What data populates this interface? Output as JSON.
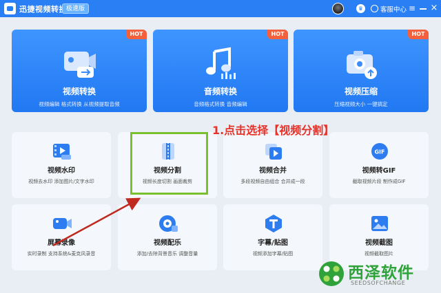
{
  "titlebar": {
    "app_title": "迅捷视频转换器",
    "edition": "极速版",
    "service_label": "客服中心",
    "menu_glyph": "≡",
    "close_glyph": "×"
  },
  "big_cards": [
    {
      "title": "视频转换",
      "desc": "视频编辑 格式转换 从视频提取音频",
      "badge": "HOT"
    },
    {
      "title": "音频转换",
      "desc": "音频格式转换 音频编辑",
      "badge": "HOT"
    },
    {
      "title": "视频压缩",
      "desc": "压缩视频大小 一键搞定",
      "badge": "HOT"
    }
  ],
  "small_cards_row1": [
    {
      "title": "视频水印",
      "desc": "视频去水印 添加图片/文字水印"
    },
    {
      "title": "视频分割",
      "desc": "视频长度切割 画面裁剪"
    },
    {
      "title": "视频合并",
      "desc": "多段视频自由组合 合并成一段"
    },
    {
      "title": "视频转GIF",
      "desc": "截取视频片段 制作成GIF"
    }
  ],
  "small_cards_row2": [
    {
      "title": "屏幕录像",
      "desc": "实时录制 支持系统&麦克风录音"
    },
    {
      "title": "视频配乐",
      "desc": "添加/去除背景音乐 调整音量"
    },
    {
      "title": "字幕/贴图",
      "desc": "视频添加字幕/贴图"
    },
    {
      "title": "视频截图",
      "desc": "视频截取图片"
    }
  ],
  "gif_badge": "GIF",
  "annotation": "1.点击选择【视频分割】",
  "watermark": {
    "name": "西泽软件",
    "domain": "SEEDSOFCHANGE"
  },
  "colors": {
    "titlebar": "#2b7ff5",
    "card_blue": "#2178f2",
    "hot": "#f4603c",
    "highlight": "#7ac02c",
    "annotation": "#e6332a",
    "watermark": "#2fa33a"
  },
  "icons": {
    "video_convert": "video-camera-icon",
    "audio_convert": "music-note-icon",
    "video_compress": "camera-compress-icon",
    "watermark": "film-watermark-icon",
    "split": "scissors-split-icon",
    "merge": "merge-play-icon",
    "gif": "gif-icon",
    "record": "camcorder-icon",
    "music": "music-disc-icon",
    "subtitle": "text-t-icon",
    "screenshot": "image-icon"
  }
}
